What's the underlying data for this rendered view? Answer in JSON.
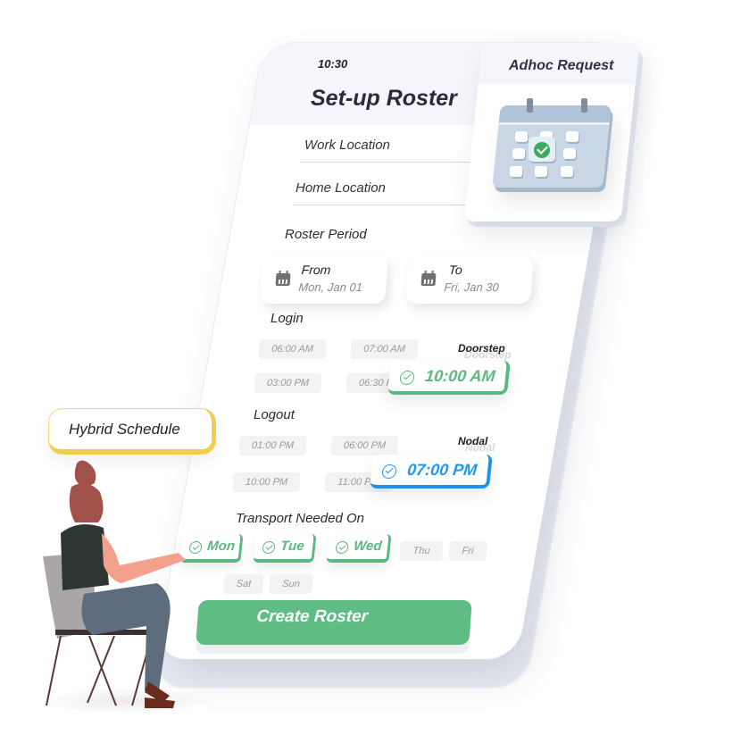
{
  "status_bar": {
    "time": "10:30"
  },
  "screen": {
    "title": "Set-up Roster",
    "fields": [
      {
        "label": "Work Location"
      },
      {
        "label": "Home Location"
      }
    ],
    "roster_period": {
      "label": "Roster Period",
      "from": {
        "label": "From",
        "value": "Mon, Jan 01",
        "icon": "calendar-icon"
      },
      "to": {
        "label": "To",
        "value": "Fri, Jan 30",
        "icon": "calendar-icon"
      }
    },
    "login": {
      "label": "Login",
      "options": [
        "06:00 AM",
        "07:00 AM",
        "03:00 PM",
        "06:30 PM"
      ],
      "selected": {
        "value": "10:00 AM",
        "tag": "Doorstep",
        "color": "#5bb97f",
        "icon": "check-circle-icon"
      }
    },
    "logout": {
      "label": "Logout",
      "options": [
        "01:00 PM",
        "06:00 PM",
        "10:00 PM",
        "11:00 PM"
      ],
      "selected": {
        "value": "07:00 PM",
        "tag": "Nodal",
        "color": "#2196f3",
        "icon": "check-circle-icon"
      }
    },
    "transport": {
      "label": "Transport Needed On",
      "selected_days": [
        "Mon",
        "Tue",
        "Wed"
      ],
      "unselected_days": [
        "Thu",
        "Fri",
        "Sat",
        "Sun"
      ]
    },
    "create_button": {
      "label": "Create Roster",
      "color": "#5fbc83"
    }
  },
  "adhoc_card": {
    "title": "Adhoc Request",
    "icon": "calendar-check-icon"
  },
  "hybrid_badge": {
    "label": "Hybrid Schedule",
    "accent": "#f3cd4d"
  },
  "illustration": {
    "subject": "woman-sitting-on-chair-pointing"
  }
}
